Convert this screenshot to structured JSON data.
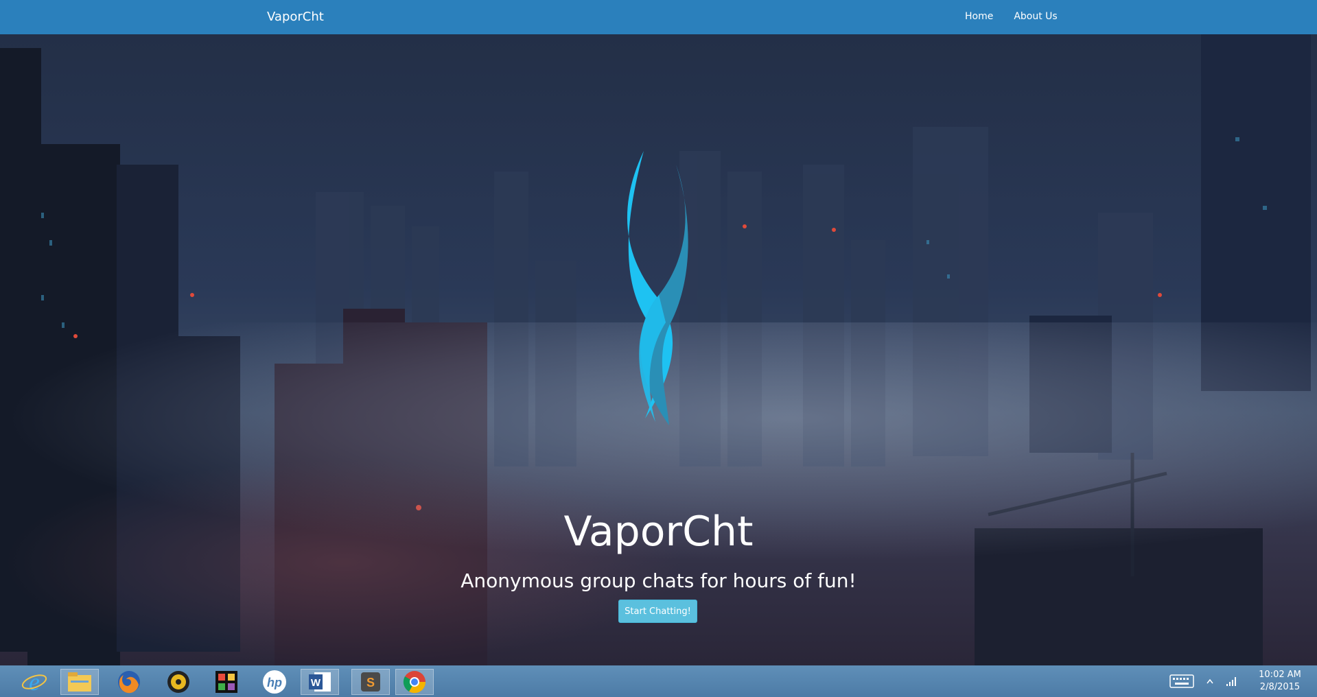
{
  "navbar": {
    "brand": "VaporCht",
    "links": [
      "Home",
      "About Us"
    ]
  },
  "hero": {
    "title": "VaporCht",
    "subtitle": "Anonymous group chats for hours of fun!",
    "button_label": "Start Chatting!"
  },
  "taskbar": {
    "apps": [
      {
        "name": "internet-explorer-icon"
      },
      {
        "name": "file-explorer-icon"
      },
      {
        "name": "firefox-icon"
      },
      {
        "name": "media-player-icon"
      },
      {
        "name": "puzzle-app-icon"
      },
      {
        "name": "hp-icon"
      },
      {
        "name": "word-icon"
      },
      {
        "name": "sublime-text-icon"
      },
      {
        "name": "chrome-icon"
      }
    ],
    "clock_time": "10:02 AM",
    "clock_date": "2/8/2015"
  },
  "colors": {
    "navbar": "#2b80bc",
    "button": "#5bc0de",
    "logo_light": "#1ec2f2",
    "logo_dark": "#2a8fb6"
  }
}
